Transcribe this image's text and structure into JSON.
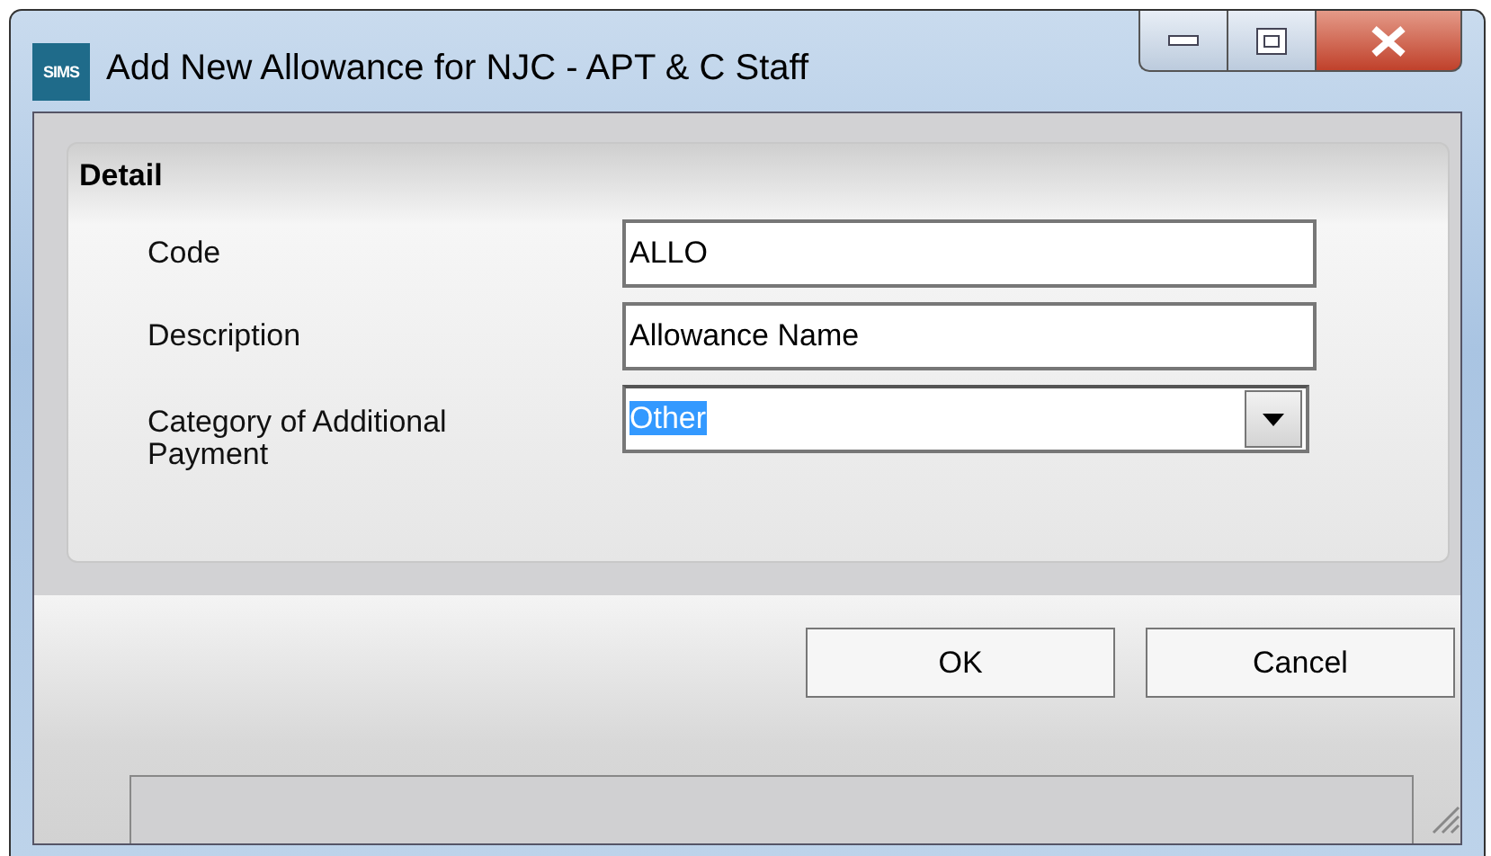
{
  "window": {
    "app_badge": "SIMS",
    "title": "Add New Allowance for NJC - APT & C Staff"
  },
  "detail": {
    "title": "Detail",
    "fields": [
      {
        "kind": "text",
        "label": "Code",
        "value": "ALLO"
      },
      {
        "kind": "text",
        "label": "Description",
        "value": "Allowance Name"
      },
      {
        "kind": "dropdown",
        "label": "Category of Additional Payment",
        "value": "Other",
        "selected": true
      }
    ]
  },
  "buttons": [
    "OK",
    "Cancel"
  ]
}
